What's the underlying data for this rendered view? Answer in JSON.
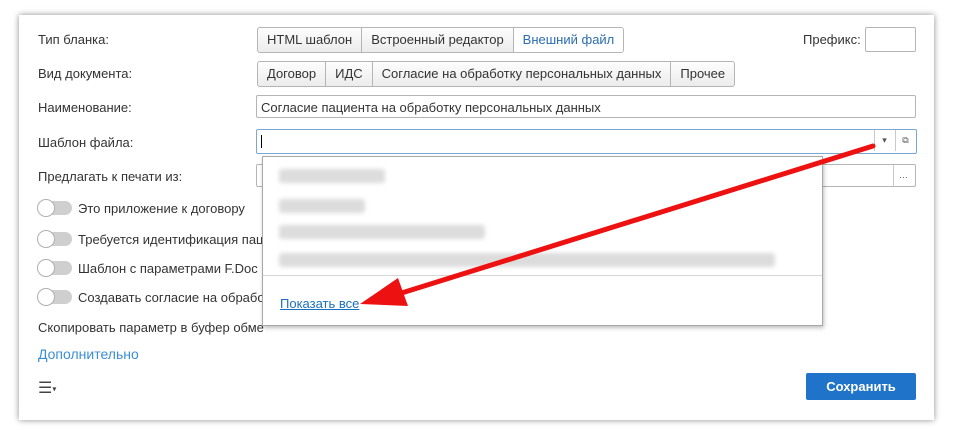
{
  "form": {
    "blank_type": {
      "label": "Тип бланка:",
      "options": [
        "HTML шаблон",
        "Встроенный редактор",
        "Внешний файл"
      ],
      "selected": "Внешний файл"
    },
    "prefix": {
      "label": "Префикс:",
      "value": ""
    },
    "doc_type": {
      "label": "Вид документа:",
      "options": [
        "Договор",
        "ИДС",
        "Согласие на обработку персональных данных",
        "Прочее"
      ]
    },
    "name": {
      "label": "Наименование:",
      "value": "Согласие пациента на обработку персональных данных"
    },
    "file_template": {
      "label": "Шаблон файла:",
      "value": ""
    },
    "print_from": {
      "label": "Предлагать к печати из:"
    },
    "toggles": [
      "Это приложение к договору",
      "Требуется идентификация пац",
      "Шаблон с параметрами F.Doc",
      "Создавать согласие на обрабо"
    ],
    "copy_param": "Скопировать параметр в буфер обме",
    "additional": "Дополнительно",
    "menu_icon": "hamburger-menu-icon",
    "save_label": "Сохранить",
    "save_color": "#1f74c9"
  },
  "dropdown": {
    "show_all": "Показать все"
  },
  "annotation": {
    "arrow_color": "#ee1111"
  }
}
